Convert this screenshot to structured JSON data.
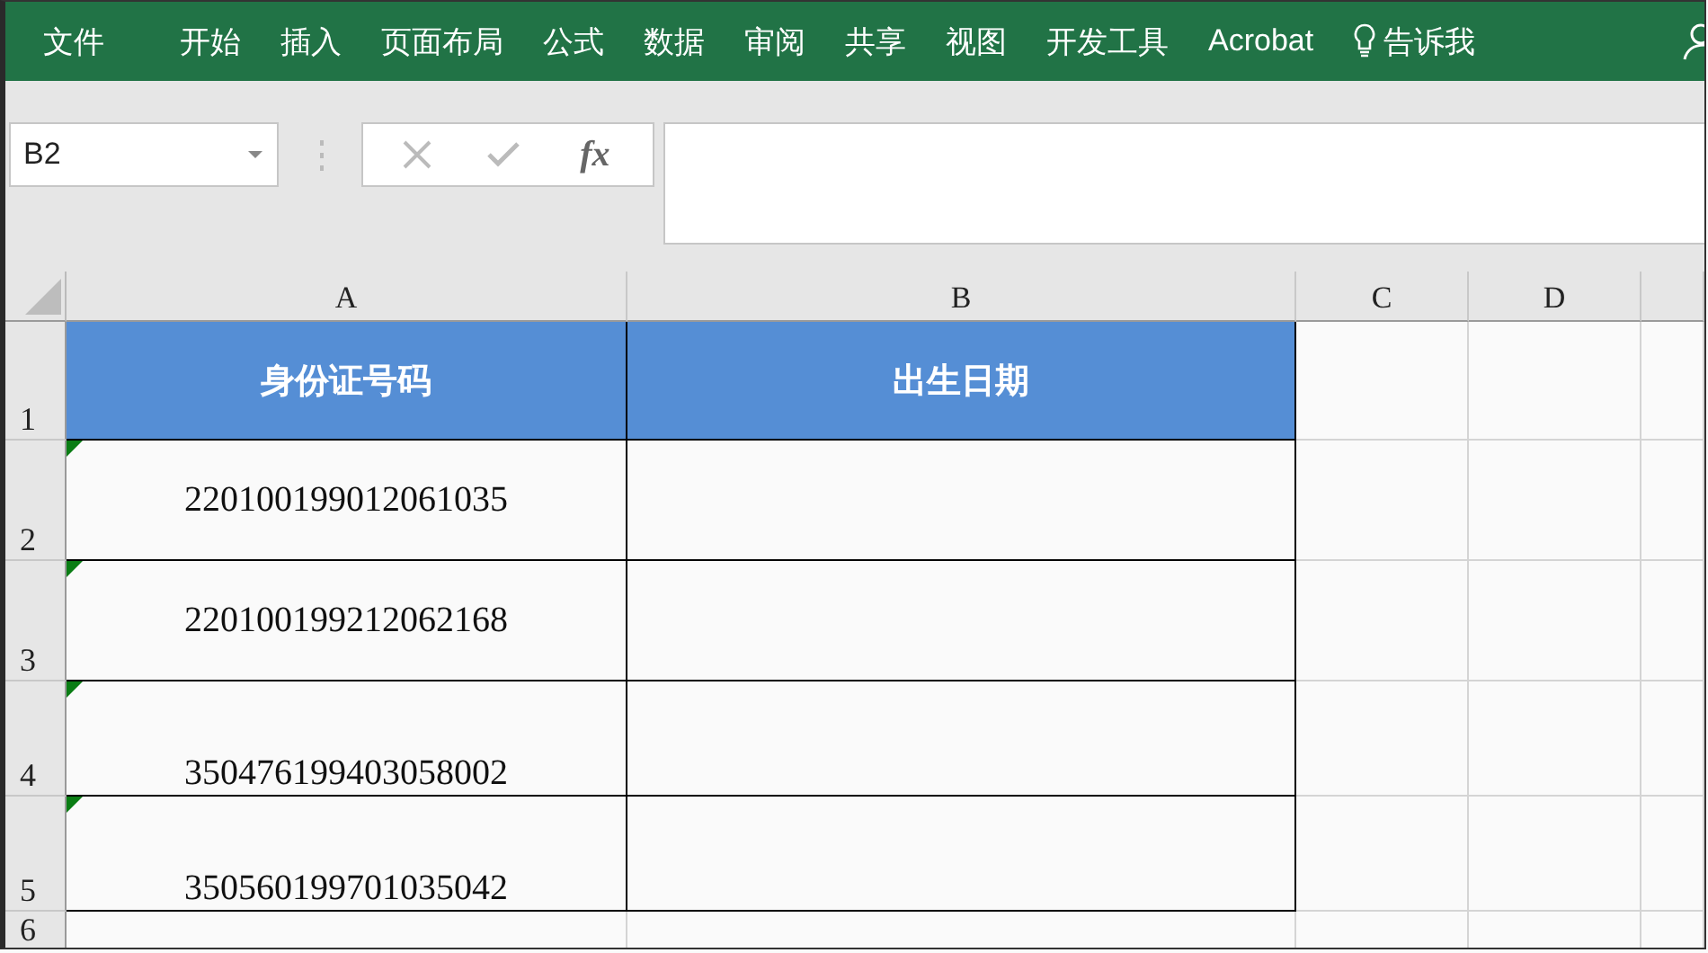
{
  "ribbon": {
    "tabs": [
      "文件",
      "开始",
      "插入",
      "页面布局",
      "公式",
      "数据",
      "审阅",
      "共享",
      "视图",
      "开发工具",
      "Acrobat"
    ],
    "tell_me": "告诉我"
  },
  "formula_bar": {
    "name_box": "B2",
    "function_button": "fx"
  },
  "sheet": {
    "columns": [
      "A",
      "B",
      "C",
      "D"
    ],
    "rows": [
      {
        "number": "1",
        "cells": [
          {
            "text": "身份证号码",
            "kind": "header"
          },
          {
            "text": "出生日期",
            "kind": "header"
          }
        ]
      },
      {
        "number": "2",
        "cells": [
          {
            "text": "220100199012061035",
            "kind": "middle",
            "error_flag": true
          },
          {
            "kind": "middle"
          }
        ]
      },
      {
        "number": "3",
        "cells": [
          {
            "text": "220100199212062168",
            "kind": "middle",
            "error_flag": true
          },
          {
            "kind": "middle"
          }
        ]
      },
      {
        "number": "4",
        "cells": [
          {
            "text": "350476199403058002",
            "kind": "bottom",
            "error_flag": true
          },
          {
            "kind": "middle"
          }
        ]
      },
      {
        "number": "5",
        "cells": [
          {
            "text": "350560199701035042",
            "kind": "bottom",
            "error_flag": true
          },
          {
            "kind": "middle"
          }
        ]
      },
      {
        "number": "6",
        "cells": []
      }
    ]
  }
}
